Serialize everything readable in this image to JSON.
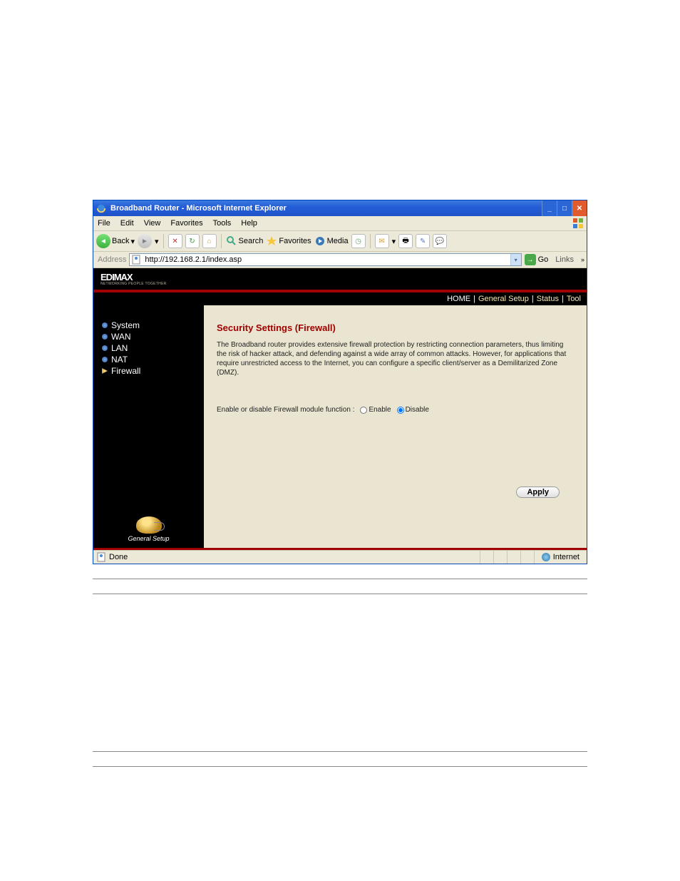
{
  "window": {
    "title": "Broadband Router - Microsoft Internet Explorer"
  },
  "menu": {
    "file": "File",
    "edit": "Edit",
    "view": "View",
    "favorites": "Favorites",
    "tools": "Tools",
    "help": "Help"
  },
  "toolbar": {
    "back": "Back",
    "search": "Search",
    "favorites": "Favorites",
    "media": "Media"
  },
  "address": {
    "label": "Address",
    "value": "http://192.168.2.1/index.asp",
    "go": "Go",
    "links": "Links"
  },
  "brand": {
    "name": "EDIMAX",
    "tag": "NETWORKING PEOPLE TOGETHER"
  },
  "topnav": {
    "home": "HOME",
    "general": "General Setup",
    "status": "Status",
    "tool": "Tool"
  },
  "sidebar": {
    "items": [
      {
        "label": "System"
      },
      {
        "label": "WAN"
      },
      {
        "label": "LAN"
      },
      {
        "label": "NAT"
      },
      {
        "label": "Firewall"
      }
    ],
    "footer": "General Setup"
  },
  "content": {
    "title": "Security Settings (Firewall)",
    "description": "The Broadband router provides extensive firewall protection by restricting connection parameters, thus limiting the risk of hacker attack, and defending against a wide array of common attacks. However, for applications that require unrestricted access to the Internet, you can configure a specific client/server as a Demilitarized Zone (DMZ).",
    "radio_label": "Enable or disable Firewall module function :",
    "enable": "Enable",
    "disable": "Disable",
    "apply": "Apply"
  },
  "status": {
    "done": "Done",
    "zone": "Internet"
  }
}
